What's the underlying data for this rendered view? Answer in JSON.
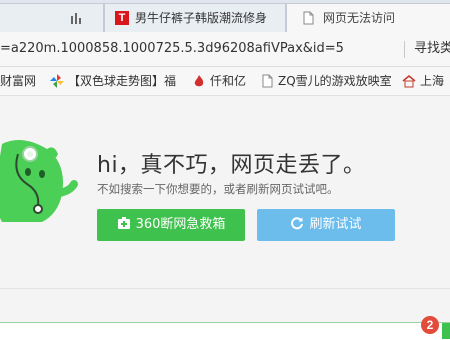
{
  "tabs": [
    {
      "title": "",
      "icon": "bar-chart-icon"
    },
    {
      "title": "男牛仔裤子韩版潮流修身",
      "icon": "tmall-icon",
      "icon_text": "T"
    },
    {
      "title": "网页无法访问",
      "icon": "page-icon"
    }
  ],
  "address_bar": {
    "url": "=a220m.1000858.1000725.5.3d96208afiVPax&id=5",
    "search_label": "寻找类"
  },
  "bookmarks": [
    {
      "label": "财富网",
      "icon": "green-leaf-icon"
    },
    {
      "label": "【双色球走势图】福",
      "icon": "pinwheel-icon"
    },
    {
      "label": "仟和亿",
      "icon": "flame-icon"
    },
    {
      "label": "ZQ雪儿的游戏放映室",
      "icon": "page-icon"
    },
    {
      "label": "上海",
      "icon": "house-icon"
    }
  ],
  "error_page": {
    "title": "hi，真不巧，网页走丢了。",
    "subtitle": "不如搜索一下你想要的，或者刷新网页试试吧。",
    "rescue_button": "360断网急救箱",
    "refresh_button": "刷新试试"
  },
  "notification_count": "2",
  "colors": {
    "green": "#3ec14d",
    "blue": "#6cbcec",
    "badge": "#e34b3a"
  }
}
